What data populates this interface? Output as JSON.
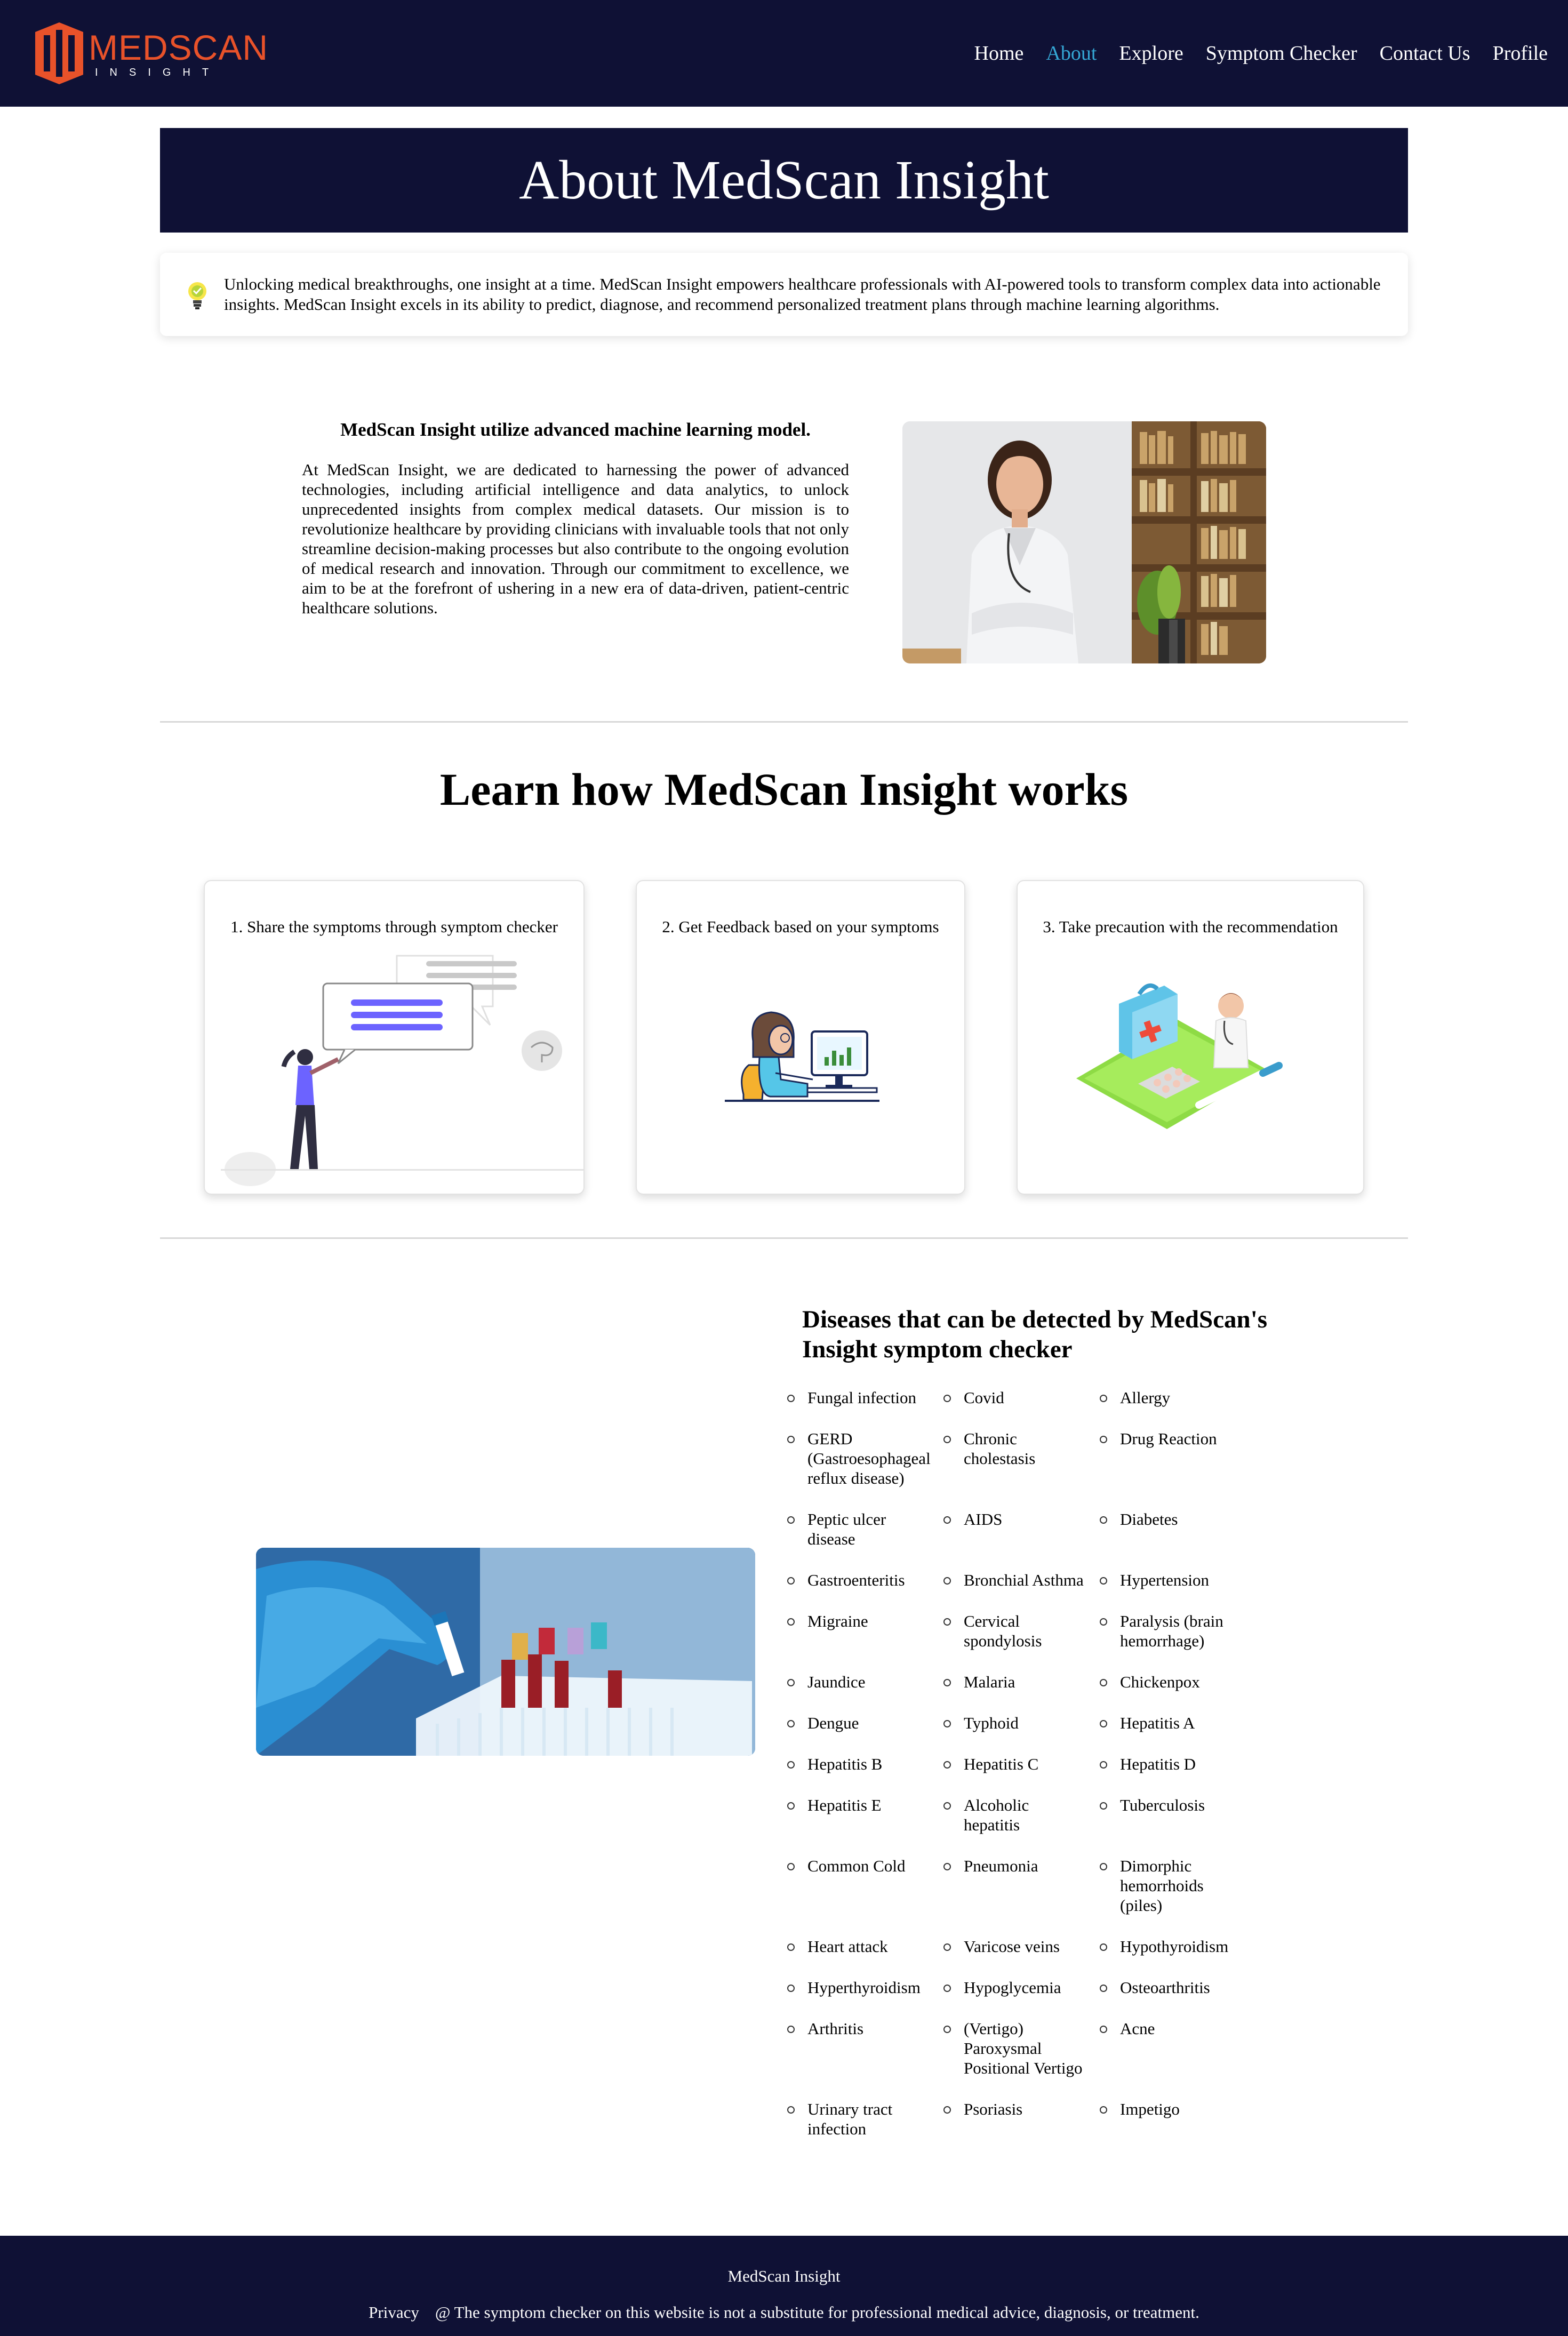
{
  "brand": {
    "name": "MEDSCAN",
    "subtitle": "INSIGHT",
    "logo_color": "#e8522a"
  },
  "nav": {
    "items": [
      {
        "label": "Home",
        "active": false
      },
      {
        "label": "About",
        "active": true
      },
      {
        "label": "Explore",
        "active": false
      },
      {
        "label": "Symptom Checker",
        "active": false
      },
      {
        "label": "Contact Us",
        "active": false
      },
      {
        "label": "Profile",
        "active": false
      }
    ]
  },
  "hero": {
    "title": "About MedScan Insight"
  },
  "intro": {
    "icon": "lightbulb-icon",
    "text": "Unlocking medical breakthroughs, one insight at a time. MedScan Insight empowers healthcare professionals with AI-powered tools to transform complex data into actionable insights. MedScan Insight excels in its ability to predict, diagnose, and recommend personalized treatment plans through machine learning algorithms."
  },
  "ml": {
    "title": "MedScan Insight utilize advanced machine learning model.",
    "body": "At MedScan Insight, we are dedicated to harnessing the power of advanced technologies, including artificial intelligence and data analytics, to unlock unprecedented insights from complex medical datasets. Our mission is to revolutionize healthcare by providing clinicians with invaluable tools that not only streamline decision-making processes but also contribute to the ongoing evolution of medical research and innovation. Through our commitment to excellence, we aim to be at the forefront of ushering in a new era of data-driven, patient-centric healthcare solutions."
  },
  "learn": {
    "title": "Learn how MedScan Insight works",
    "steps": [
      {
        "label": "1. Share the symptoms through symptom checker"
      },
      {
        "label": "2. Get Feedback based on your symptoms"
      },
      {
        "label": "3. Take precaution with the recommendation"
      }
    ]
  },
  "diseases": {
    "title": "Diseases that can be detected by MedScan's Insight symptom checker",
    "items": [
      "Fungal infection",
      "Covid",
      "Allergy",
      "GERD (Gastroesophageal reflux disease)",
      "Chronic cholestasis",
      "Drug Reaction",
      "Peptic ulcer disease",
      "AIDS",
      "Diabetes",
      "Gastroenteritis",
      "Bronchial Asthma",
      "Hypertension",
      "Migraine",
      "Cervical spondylosis",
      "Paralysis (brain hemorrhage)",
      "Jaundice",
      "Malaria",
      "Chickenpox",
      "Dengue",
      "Typhoid",
      "Hepatitis A",
      "Hepatitis B",
      "Hepatitis C",
      "Hepatitis D",
      "Hepatitis E",
      "Alcoholic hepatitis",
      "Tuberculosis",
      "Common Cold",
      "Pneumonia",
      "Dimorphic hemorrhoids (piles)",
      "Heart attack",
      "Varicose veins",
      "Hypothyroidism",
      "Hyperthyroidism",
      "Hypoglycemia",
      "Osteoarthritis",
      "Arthritis",
      "(Vertigo) Paroxysmal Positional Vertigo",
      "Acne",
      "Urinary tract infection",
      "Psoriasis",
      "Impetigo"
    ]
  },
  "footer": {
    "brand": "MedScan Insight",
    "privacy": "Privacy",
    "disclaimer": "@ The symptom checker on this website is not a substitute for professional medical advice, diagnosis, or treatment."
  },
  "colors": {
    "navy": "#0f1135",
    "accent": "#35a8d6",
    "logo": "#e8522a",
    "illustration_purple": "#6c63ff"
  }
}
